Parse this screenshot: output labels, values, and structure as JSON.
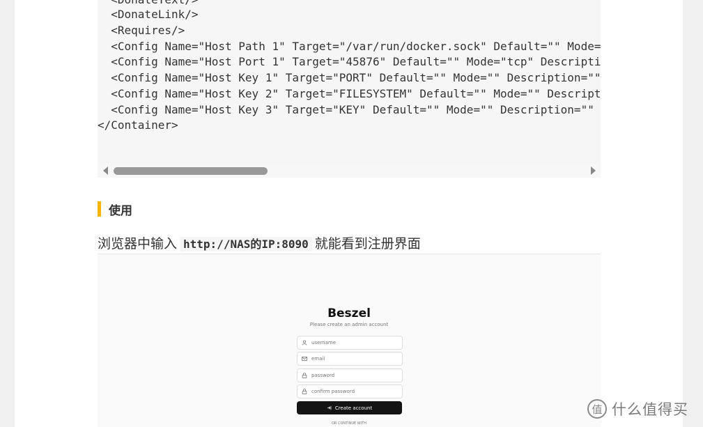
{
  "code": {
    "lines": [
      "  <DonateText/>",
      "  <DonateLink/>",
      "  <Requires/>",
      "  <Config Name=\"Host Path 1\" Target=\"/var/run/docker.sock\" Default=\"\" Mode=\"\" Description=\"\" Type=\"Path\"",
      "  <Config Name=\"Host Port 1\" Target=\"45876\" Default=\"\" Mode=\"tcp\" Description=\"\" Type=\"Port\"",
      "  <Config Name=\"Host Key 1\" Target=\"PORT\" Default=\"\" Mode=\"\" Description=\"\" Type=\"Variable\"",
      "  <Config Name=\"Host Key 2\" Target=\"FILESYSTEM\" Default=\"\" Mode=\"\" Description=\"\" Type=\"Variable\"",
      "  <Config Name=\"Host Key 3\" Target=\"KEY\" Default=\"\" Mode=\"\" Description=\"\" Type=\"Variable\"",
      "</Container>"
    ]
  },
  "section": {
    "heading": "使用"
  },
  "paragraph": {
    "before": "浏览器中输入",
    "code": "http://NAS的IP:8090",
    "after": "就能看到注册界面"
  },
  "beszel": {
    "title": "Beszel",
    "subtitle": "Please create an admin account",
    "username_placeholder": "username",
    "email_placeholder": "email",
    "password_placeholder": "password",
    "confirm_placeholder": "confirm password",
    "create_label": "Create account",
    "or_text": "OR CONTINUE WITH"
  },
  "watermark": {
    "text": "什么值得买"
  },
  "colors": {
    "heading_accent": "#f7b500",
    "button_bg": "#141414"
  }
}
